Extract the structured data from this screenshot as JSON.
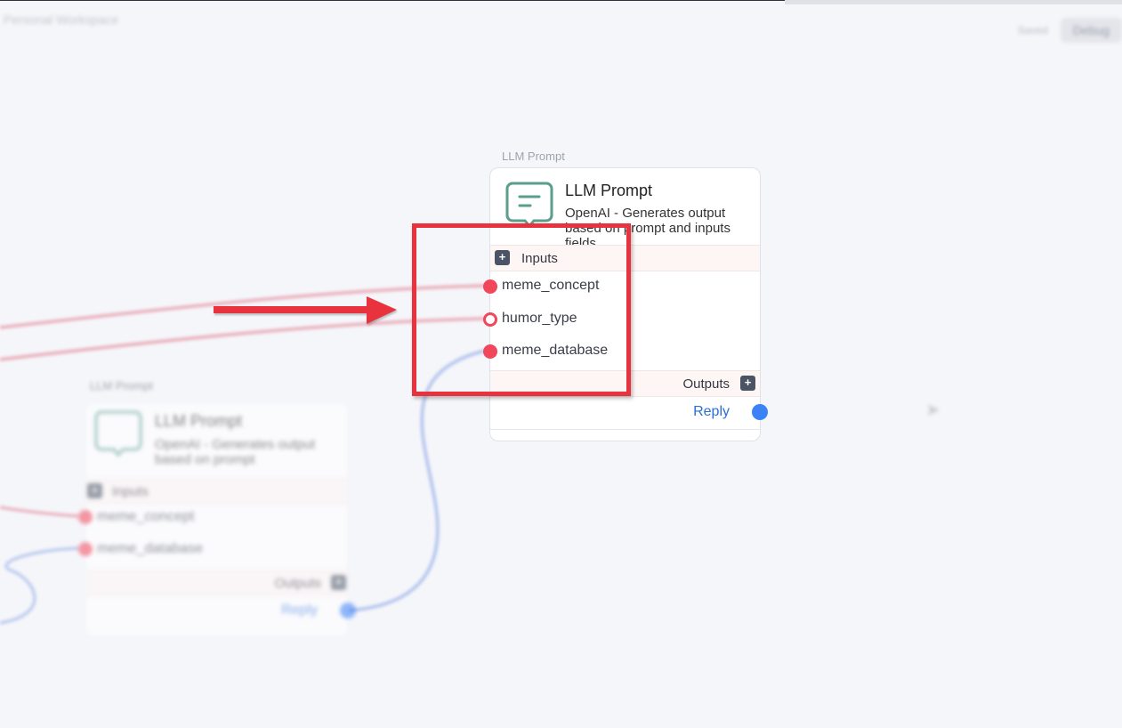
{
  "breadcrumb": "Personal Workspace",
  "top_right": {
    "history_label": "Saved",
    "debug_label": "Debug"
  },
  "main_node": {
    "caption": "LLM Prompt",
    "title": "LLM Prompt",
    "description": "OpenAI - Generates output based on prompt and inputs fields",
    "inputs_label": "Inputs",
    "inputs": [
      {
        "name": "meme_concept",
        "state": "connected"
      },
      {
        "name": "humor_type",
        "state": "unconnected"
      },
      {
        "name": "meme_database",
        "state": "connected"
      }
    ],
    "outputs_label": "Outputs",
    "output": "Reply"
  },
  "back_node": {
    "caption": "LLM Prompt",
    "title": "LLM Prompt",
    "description": "OpenAI - Generates output based on prompt",
    "inputs_label": "Inputs",
    "inputs": [
      "meme_concept",
      "meme_database"
    ],
    "outputs_label": "Outputs",
    "output": "Reply"
  },
  "icons": {
    "node_icon": "chat-bubble-icon",
    "plus": "plus-icon",
    "arrow": "annotation-arrow-icon"
  },
  "colors": {
    "background": "#f5f6fa",
    "input_port": "#f0485a",
    "output_port": "#3b82f6",
    "annotation": "#e8333f",
    "icon_accent": "#5a9e8c"
  }
}
